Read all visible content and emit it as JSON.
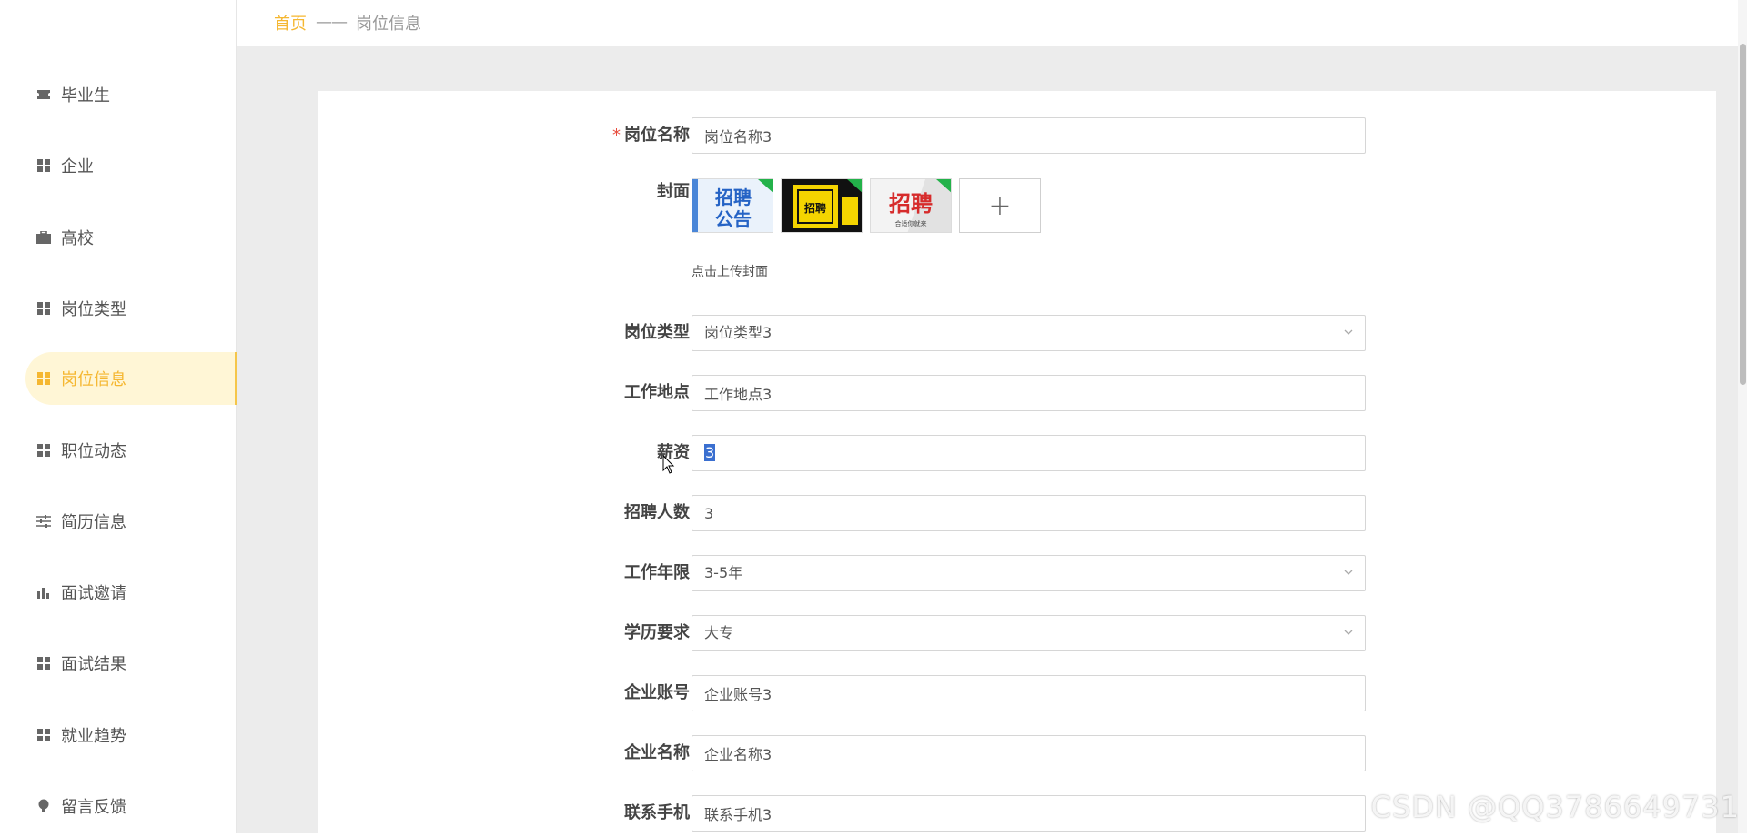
{
  "sidebar": {
    "items": [
      {
        "label": "毕业生",
        "icon": "ticket-icon"
      },
      {
        "label": "企业",
        "icon": "grid-icon"
      },
      {
        "label": "高校",
        "icon": "briefcase-icon"
      },
      {
        "label": "岗位类型",
        "icon": "grid-icon"
      },
      {
        "label": "岗位信息",
        "icon": "grid-icon",
        "active": true
      },
      {
        "label": "职位动态",
        "icon": "grid-icon"
      },
      {
        "label": "简历信息",
        "icon": "sliders-icon"
      },
      {
        "label": "面试邀请",
        "icon": "bar-chart-icon"
      },
      {
        "label": "面试结果",
        "icon": "grid-icon"
      },
      {
        "label": "就业趋势",
        "icon": "grid-icon"
      },
      {
        "label": "留言反馈",
        "icon": "bulb-icon"
      }
    ]
  },
  "breadcrumb": {
    "home": "首页",
    "separator": "——",
    "current": "岗位信息"
  },
  "form": {
    "job_name": {
      "label": "岗位名称",
      "value": "岗位名称3",
      "required_mark": "*"
    },
    "cover": {
      "label": "封面",
      "hint": "点击上传封面",
      "thumbs": [
        {
          "text1": "招聘",
          "text2": "公告"
        },
        {
          "text1": "招聘"
        },
        {
          "text1": "招聘",
          "text2": "合适你就来"
        }
      ],
      "add_symbol": "+"
    },
    "job_type": {
      "label": "岗位类型",
      "value": "岗位类型3"
    },
    "location": {
      "label": "工作地点",
      "value": "工作地点3"
    },
    "salary": {
      "label": "薪资",
      "value": "3"
    },
    "headcount": {
      "label": "招聘人数",
      "value": "3"
    },
    "experience": {
      "label": "工作年限",
      "value": "3-5年"
    },
    "education": {
      "label": "学历要求",
      "value": "大专"
    },
    "company_account": {
      "label": "企业账号",
      "value": "企业账号3"
    },
    "company_name": {
      "label": "企业名称",
      "value": "企业名称3"
    },
    "phone": {
      "label": "联系手机",
      "value": "联系手机3"
    }
  },
  "watermark": "CSDN @QQ3786649731",
  "colors": {
    "accent": "#f5b731",
    "active_bg": "#fff6d6",
    "required": "#e84c3d",
    "main_bg": "#ececec"
  }
}
